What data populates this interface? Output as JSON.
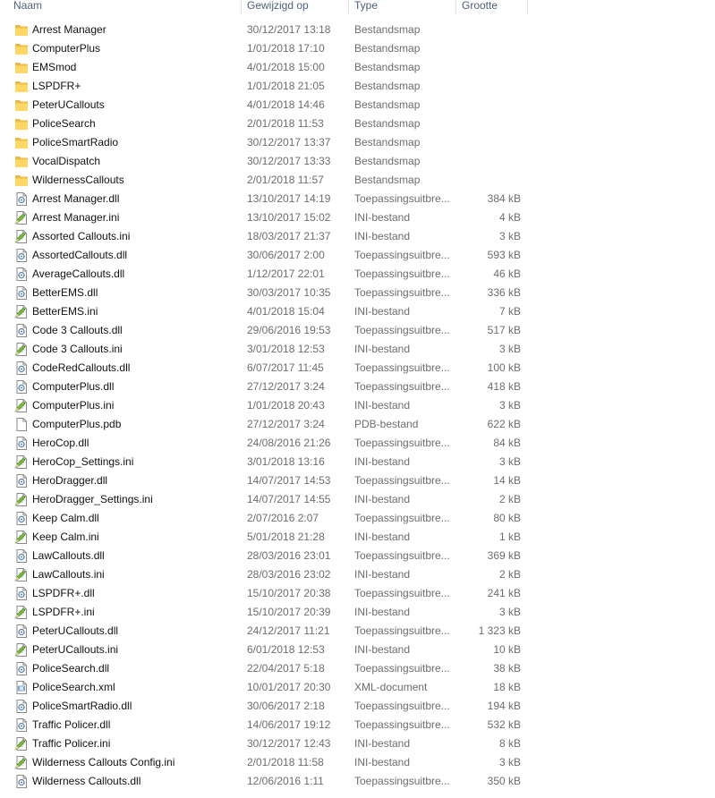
{
  "columns": {
    "name": "Naam",
    "modified": "Gewijzigd op",
    "type": "Type",
    "size": "Grootte"
  },
  "files": [
    {
      "name": "Arrest Manager",
      "modified": "30/12/2017 13:18",
      "type": "Bestandsmap",
      "size": "",
      "icon": "folder-icon"
    },
    {
      "name": "ComputerPlus",
      "modified": "1/01/2018 17:10",
      "type": "Bestandsmap",
      "size": "",
      "icon": "folder-icon"
    },
    {
      "name": "EMSmod",
      "modified": "4/01/2018 15:00",
      "type": "Bestandsmap",
      "size": "",
      "icon": "folder-icon"
    },
    {
      "name": "LSPDFR+",
      "modified": "1/01/2018 21:05",
      "type": "Bestandsmap",
      "size": "",
      "icon": "folder-icon"
    },
    {
      "name": "PeterUCallouts",
      "modified": "4/01/2018 14:46",
      "type": "Bestandsmap",
      "size": "",
      "icon": "folder-icon"
    },
    {
      "name": "PoliceSearch",
      "modified": "2/01/2018 11:53",
      "type": "Bestandsmap",
      "size": "",
      "icon": "folder-icon"
    },
    {
      "name": "PoliceSmartRadio",
      "modified": "30/12/2017 13:37",
      "type": "Bestandsmap",
      "size": "",
      "icon": "folder-icon"
    },
    {
      "name": "VocalDispatch",
      "modified": "30/12/2017 13:33",
      "type": "Bestandsmap",
      "size": "",
      "icon": "folder-icon"
    },
    {
      "name": "WildernessCallouts",
      "modified": "2/01/2018 11:57",
      "type": "Bestandsmap",
      "size": "",
      "icon": "folder-icon"
    },
    {
      "name": "Arrest Manager.dll",
      "modified": "13/10/2017 14:19",
      "type": "Toepassingsuitbre...",
      "size": "384 kB",
      "icon": "dll-icon"
    },
    {
      "name": "Arrest Manager.ini",
      "modified": "13/10/2017 15:02",
      "type": "INI-bestand",
      "size": "4 kB",
      "icon": "ini-icon"
    },
    {
      "name": "Assorted Callouts.ini",
      "modified": "18/03/2017 21:37",
      "type": "INI-bestand",
      "size": "3 kB",
      "icon": "ini-icon"
    },
    {
      "name": "AssortedCallouts.dll",
      "modified": "30/06/2017 2:00",
      "type": "Toepassingsuitbre...",
      "size": "593 kB",
      "icon": "dll-icon"
    },
    {
      "name": "AverageCallouts.dll",
      "modified": "1/12/2017 22:01",
      "type": "Toepassingsuitbre...",
      "size": "46 kB",
      "icon": "dll-icon"
    },
    {
      "name": "BetterEMS.dll",
      "modified": "30/03/2017 10:35",
      "type": "Toepassingsuitbre...",
      "size": "336 kB",
      "icon": "dll-icon"
    },
    {
      "name": "BetterEMS.ini",
      "modified": "4/01/2018 15:04",
      "type": "INI-bestand",
      "size": "7 kB",
      "icon": "ini-icon"
    },
    {
      "name": "Code 3 Callouts.dll",
      "modified": "29/06/2016 19:53",
      "type": "Toepassingsuitbre...",
      "size": "517 kB",
      "icon": "dll-icon"
    },
    {
      "name": "Code 3 Callouts.ini",
      "modified": "3/01/2018 12:53",
      "type": "INI-bestand",
      "size": "3 kB",
      "icon": "ini-icon"
    },
    {
      "name": "CodeRedCallouts.dll",
      "modified": "6/07/2017 11:45",
      "type": "Toepassingsuitbre...",
      "size": "100 kB",
      "icon": "dll-icon"
    },
    {
      "name": "ComputerPlus.dll",
      "modified": "27/12/2017 3:24",
      "type": "Toepassingsuitbre...",
      "size": "418 kB",
      "icon": "dll-icon"
    },
    {
      "name": "ComputerPlus.ini",
      "modified": "1/01/2018 20:43",
      "type": "INI-bestand",
      "size": "3 kB",
      "icon": "ini-icon"
    },
    {
      "name": "ComputerPlus.pdb",
      "modified": "27/12/2017 3:24",
      "type": "PDB-bestand",
      "size": "622 kB",
      "icon": "blank-file-icon"
    },
    {
      "name": "HeroCop.dll",
      "modified": "24/08/2016 21:26",
      "type": "Toepassingsuitbre...",
      "size": "84 kB",
      "icon": "dll-icon"
    },
    {
      "name": "HeroCop_Settings.ini",
      "modified": "3/01/2018 13:16",
      "type": "INI-bestand",
      "size": "3 kB",
      "icon": "ini-icon"
    },
    {
      "name": "HeroDragger.dll",
      "modified": "14/07/2017 14:53",
      "type": "Toepassingsuitbre...",
      "size": "14 kB",
      "icon": "dll-icon"
    },
    {
      "name": "HeroDragger_Settings.ini",
      "modified": "14/07/2017 14:55",
      "type": "INI-bestand",
      "size": "2 kB",
      "icon": "ini-icon"
    },
    {
      "name": "Keep Calm.dll",
      "modified": "2/07/2016 2:07",
      "type": "Toepassingsuitbre...",
      "size": "80 kB",
      "icon": "dll-icon"
    },
    {
      "name": "Keep Calm.ini",
      "modified": "5/01/2018 21:28",
      "type": "INI-bestand",
      "size": "1 kB",
      "icon": "ini-icon"
    },
    {
      "name": "LawCallouts.dll",
      "modified": "28/03/2016 23:01",
      "type": "Toepassingsuitbre...",
      "size": "369 kB",
      "icon": "dll-icon"
    },
    {
      "name": "LawCallouts.ini",
      "modified": "28/03/2016 23:02",
      "type": "INI-bestand",
      "size": "2 kB",
      "icon": "ini-icon"
    },
    {
      "name": "LSPDFR+.dll",
      "modified": "15/10/2017 20:38",
      "type": "Toepassingsuitbre...",
      "size": "241 kB",
      "icon": "dll-icon"
    },
    {
      "name": "LSPDFR+.ini",
      "modified": "15/10/2017 20:39",
      "type": "INI-bestand",
      "size": "3 kB",
      "icon": "ini-icon"
    },
    {
      "name": "PeterUCallouts.dll",
      "modified": "24/12/2017 11:21",
      "type": "Toepassingsuitbre...",
      "size": "1 323 kB",
      "icon": "dll-icon"
    },
    {
      "name": "PeterUCallouts.ini",
      "modified": "6/01/2018 12:53",
      "type": "INI-bestand",
      "size": "10 kB",
      "icon": "ini-icon"
    },
    {
      "name": "PoliceSearch.dll",
      "modified": "22/04/2017 5:18",
      "type": "Toepassingsuitbre...",
      "size": "38 kB",
      "icon": "dll-icon"
    },
    {
      "name": "PoliceSearch.xml",
      "modified": "10/01/2017 20:30",
      "type": "XML-document",
      "size": "18 kB",
      "icon": "xml-icon"
    },
    {
      "name": "PoliceSmartRadio.dll",
      "modified": "30/06/2017 2:18",
      "type": "Toepassingsuitbre...",
      "size": "194 kB",
      "icon": "dll-icon"
    },
    {
      "name": "Traffic Policer.dll",
      "modified": "14/06/2017 19:12",
      "type": "Toepassingsuitbre...",
      "size": "532 kB",
      "icon": "dll-icon"
    },
    {
      "name": "Traffic Policer.ini",
      "modified": "30/12/2017 12:43",
      "type": "INI-bestand",
      "size": "8 kB",
      "icon": "ini-icon"
    },
    {
      "name": "Wilderness Callouts Config.ini",
      "modified": "2/01/2018 11:58",
      "type": "INI-bestand",
      "size": "3 kB",
      "icon": "ini-icon"
    },
    {
      "name": "Wilderness Callouts.dll",
      "modified": "12/06/2016 1:11",
      "type": "Toepassingsuitbre...",
      "size": "350 kB",
      "icon": "dll-icon"
    }
  ]
}
